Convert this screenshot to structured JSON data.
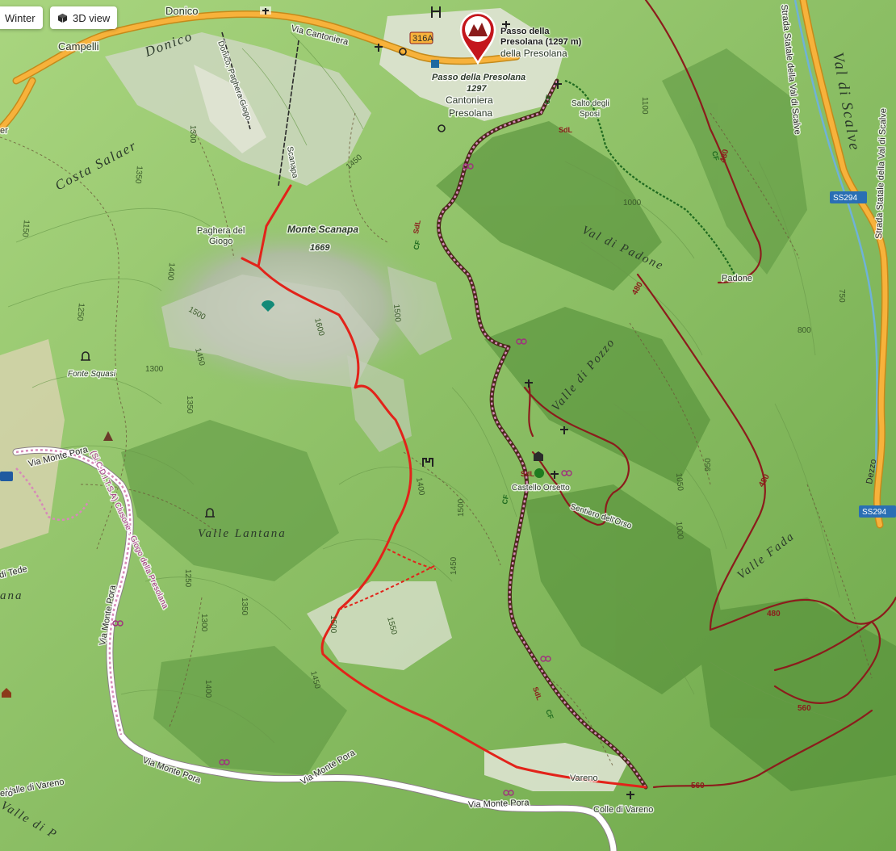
{
  "controls": {
    "winter_label": "Winter",
    "view3d_label": "3D view"
  },
  "colors": {
    "terrain": "#8fc46a",
    "route": "#e2231a",
    "trail": "#8b1c1c",
    "cycle": "#a0307e",
    "main_road": "#f7b23b"
  },
  "marker": {
    "icon": "mountain-pass-icon",
    "title_line1": "Passo della",
    "title_line2": "Presolana (1297 m)"
  },
  "places": {
    "donico_top": "Donico",
    "donico_large": "Donico",
    "campelli": "Campelli",
    "via_cantoniera": "Via Cantoniera",
    "road_316a": "316A",
    "della_presolana": "della Presolana",
    "passo_presolana": "Passo della Presolana",
    "passo_alt": "1297",
    "cantoniera": "Cantoniera",
    "cantoniera2": "Presolana",
    "salto_sposi_1": "Salto degli",
    "salto_sposi_2": "Sposi",
    "costa_salaer": "Costa Salaer",
    "donico_paghera": "Donico, Paghera Giogo",
    "scanapa": "Scanapa",
    "monte_scanapa": "Monte Scanapa",
    "monte_scanapa_alt": "1669",
    "paghera_1": "Paghera del",
    "paghera_2": "Giogo",
    "fonte_squasi": "Fonte Squasi",
    "val_di_padone": "Val di Padone",
    "padone": "Padone",
    "valle_di_pozzo": "Valle di Pozzo",
    "castello_orsetto": "Castello Orsetto",
    "sentiero_orso": "Sentiero dell'Orso",
    "valle_lantana": "Valle Lantana",
    "valle_fada": "Valle Fada",
    "val_di_scalve": "Val di Scalve",
    "strada_statale_1": "Strada Statale della Val di Scalve",
    "strada_statale_2": "Strada Statale della Val di Scalve",
    "ss294_a": "SS294",
    "ss294_b": "SS294",
    "dezzo": "Dezzo",
    "via_monte_pora_1": "Via Monte Pora",
    "via_monte_pora_2": "Via Monte Pora",
    "via_monte_pora_3": "Via Monte Pora",
    "via_monte_pora_4": "Via Monte Pora",
    "via_monte_pora_5": "Via Monte Pora",
    "via_monte_pora_6": "Via Monte Pora",
    "cycle_label": "(Si.C.D.I.T.S.A) Clusone - Giogo della Presolana",
    "vareno": "Vareno",
    "colle_vareno": "Colle di Vareno",
    "valle_di_vareno": "Valle di Vareno",
    "valle_di_p": "Valle di P",
    "edge_er": "er",
    "edge_ana": "ana",
    "edge_tede": "di Tede",
    "edge_ero": "ero"
  },
  "routes": {
    "r480a": "480",
    "r480b": "480",
    "r480c": "480",
    "r480d": "480",
    "r560a": "560",
    "r560b": "560",
    "cf1": "CF",
    "cf2": "CF",
    "cf3": "CF",
    "cf4": "CF",
    "cf5": "CF",
    "sdl1": "SdL",
    "sdl2": "SdL",
    "sdl3": "SdL",
    "sdl4": "SdL"
  },
  "contours": {
    "c1100": "1100",
    "c1300a": "1300",
    "c1450top": "1450",
    "c1350a": "1350",
    "c1150": "1150",
    "c1400a": "1400",
    "c1250": "1250",
    "c1500a": "1500",
    "c1450a": "1450",
    "c1300b": "1300",
    "c1350b": "1350",
    "c1600": "1600",
    "c1500b": "1500",
    "c1400b": "1400",
    "c1500c": "1500",
    "c1450b": "1450",
    "c1250b": "1250",
    "c1350c": "1350",
    "c1300c": "1300",
    "c1550": "1550",
    "c1500d": "1500",
    "c1450c": "1450",
    "c1400c": "1400",
    "c1000a": "1000",
    "c1050": "1050",
    "c950": "950",
    "c1000b": "1000",
    "c800": "800",
    "c750": "750"
  }
}
